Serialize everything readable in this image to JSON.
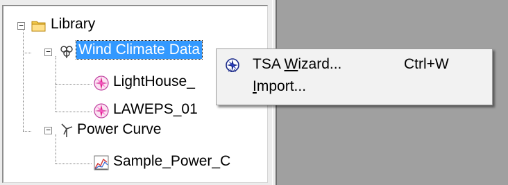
{
  "tree": {
    "root": {
      "label": "Library",
      "icon": "folder-icon",
      "expander": "−"
    },
    "wind_climate": {
      "label": "Wind Climate Data",
      "icon": "wind-climate-icon",
      "expander": "−",
      "selected": true
    },
    "children_wind": [
      {
        "label": "LightHouse_",
        "icon": "wind-rose-icon"
      },
      {
        "label": "LAWEPS_01",
        "icon": "wind-rose-icon"
      }
    ],
    "power_curve": {
      "label": "Power Curve",
      "icon": "wind-turbine-icon",
      "expander": "−"
    },
    "children_power": [
      {
        "label": "Sample_Power_C",
        "icon": "power-chart-icon"
      }
    ]
  },
  "context_menu": {
    "items": [
      {
        "label_pre": "TSA ",
        "label_accel": "W",
        "label_post": "izard...",
        "shortcut": "Ctrl+W",
        "icon": "tsa-wizard-icon"
      },
      {
        "label_pre": "",
        "label_accel": "I",
        "label_post": "mport...",
        "shortcut": "",
        "icon": ""
      }
    ]
  },
  "colors": {
    "selection": "#3399ff",
    "background": "#a0a0a0",
    "panel": "#ffffff"
  }
}
